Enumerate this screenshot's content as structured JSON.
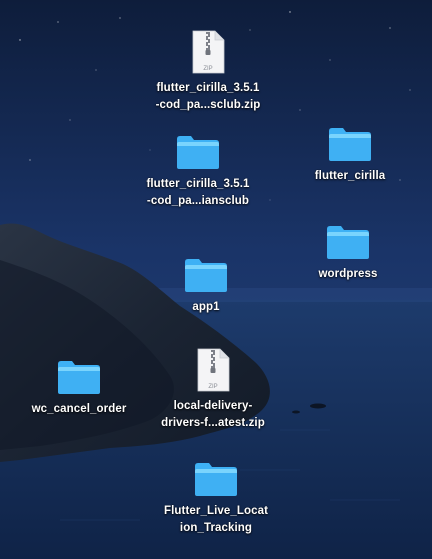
{
  "desktop": {
    "icons": [
      {
        "label": "flutter_cirilla_3.5.1\n-cod_pa...sclub.zip",
        "kind": "zip",
        "badge": "ZIP"
      },
      {
        "label": "flutter_cirilla_3.5.1\n-cod_pa...iansclub",
        "kind": "folder"
      },
      {
        "label": "flutter_cirilla",
        "kind": "folder"
      },
      {
        "label": "wordpress",
        "kind": "folder"
      },
      {
        "label": "app1",
        "kind": "folder"
      },
      {
        "label": "wc_cancel_order",
        "kind": "folder"
      },
      {
        "label": "local-delivery-\ndrivers-f...atest.zip",
        "kind": "zip",
        "badge": "ZIP"
      },
      {
        "label": "Flutter_Live_Locat\nion_Tracking",
        "kind": "folder"
      }
    ]
  },
  "colors": {
    "folder_top": "#5fc8fb",
    "folder_bottom": "#2aa2ef",
    "sky": "#1c3a72",
    "sea": "#16315e",
    "cliff": "#1f2a3a"
  }
}
